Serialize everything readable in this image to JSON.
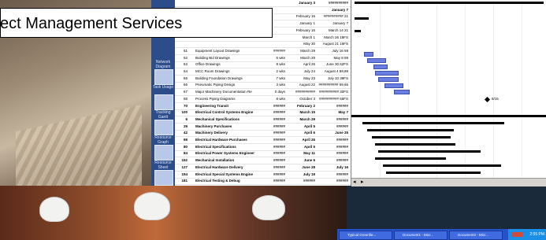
{
  "title": "ect Management Services",
  "side_rail": [
    {
      "label": "Network Diagram"
    },
    {
      "label": "Task Usage"
    },
    {
      "label": "Tracking Gantt"
    },
    {
      "label": "Resource Graph"
    },
    {
      "label": "Resource Sheet"
    }
  ],
  "rows": [
    {
      "id": "",
      "name": "",
      "dur": "",
      "start": "January 3",
      "end": "##########",
      "bold": true
    },
    {
      "id": "",
      "name": "",
      "dur": "",
      "start": "",
      "end": "January 7",
      "bold": true
    },
    {
      "id": "",
      "name": "",
      "dur": "",
      "start": "February 16",
      "end": "########## 21",
      "bold": false
    },
    {
      "id": "",
      "name": "",
      "dur": "",
      "start": "January 1",
      "end": "January 7",
      "bold": false
    },
    {
      "id": "",
      "name": "",
      "dur": "",
      "start": "February 16",
      "end": "March 14 21",
      "bold": false
    },
    {
      "id": "",
      "name": "",
      "dur": "",
      "start": "March 1",
      "end": "March 26 18FS",
      "bold": false
    },
    {
      "id": "",
      "name": "",
      "dur": "",
      "start": "May 30",
      "end": "August 21 16FS",
      "bold": false
    },
    {
      "id": "61",
      "name": "Equipment Layout Drawings",
      "dur": "######",
      "start": "March 29",
      "end": "July 16 59",
      "bold": false
    },
    {
      "id": "62",
      "name": "Building Bid Drawings",
      "dur": "6 wks",
      "start": "March 29",
      "end": "May 8 59",
      "bold": false
    },
    {
      "id": "63",
      "name": "Office Drawings",
      "dur": "8 wks",
      "start": "April 26",
      "end": "June 30 62FS",
      "bold": false
    },
    {
      "id": "64",
      "name": "MCC Room Drawings",
      "dur": "2 wks",
      "start": "July 24",
      "end": "August 4 59,89",
      "bold": false
    },
    {
      "id": "65",
      "name": "Building Foundation Drawings",
      "dur": "7 wks",
      "start": "May 23",
      "end": "July 10 39FS",
      "bold": false
    },
    {
      "id": "66",
      "name": "Pneumatic Piping Design",
      "dur": "3 wks",
      "start": "August 22",
      "end": "########## 59,65",
      "bold": false
    },
    {
      "id": "67",
      "name": "Major Machinery Documentation Re",
      "dur": "0 days",
      "start": "##########",
      "end": "########## 30FS",
      "bold": false
    },
    {
      "id": "68",
      "name": "Process Piping Diagrams",
      "dur": "8 wks",
      "start": "October 3",
      "end": "########## 65FS",
      "bold": false
    },
    {
      "id": "70",
      "name": "Engineering Transit",
      "dur": "######",
      "start": "February 2",
      "end": "######",
      "bold": true
    },
    {
      "id": "100",
      "name": "Electrical Control Systems Engine",
      "dur": "######",
      "start": "March 15",
      "end": "May 7",
      "bold": true
    },
    {
      "id": "6",
      "name": "Mechanical Specifications",
      "dur": "######",
      "start": "March 29",
      "end": "######",
      "bold": true
    },
    {
      "id": "29",
      "name": "Machinery Purchases",
      "dur": "######",
      "start": "April 5",
      "end": "######",
      "bold": true
    },
    {
      "id": "42",
      "name": "Machinery Delivery",
      "dur": "######",
      "start": "April 6",
      "end": "June 25",
      "bold": true
    },
    {
      "id": "69",
      "name": "Electrical Hardware Purchases",
      "dur": "######",
      "start": "April 26",
      "end": "######",
      "bold": true
    },
    {
      "id": "80",
      "name": "Electrical Specifications",
      "dur": "######",
      "start": "April 5",
      "end": "######",
      "bold": true
    },
    {
      "id": "84",
      "name": "Electrical Power Systems Engineer",
      "dur": "######",
      "start": "May 11",
      "end": "######",
      "bold": true
    },
    {
      "id": "162",
      "name": "Mechanical Installation",
      "dur": "######",
      "start": "June 6",
      "end": "######",
      "bold": true
    },
    {
      "id": "127",
      "name": "Electrical Hardware Delivery",
      "dur": "######",
      "start": "June 28",
      "end": "July 16",
      "bold": true
    },
    {
      "id": "194",
      "name": "Electrical Special Systems Engine",
      "dur": "######",
      "start": "July 19",
      "end": "######",
      "bold": true
    },
    {
      "id": "181",
      "name": "Electrical Testing & Debug",
      "dur": "######",
      "start": "######",
      "end": "######",
      "bold": true
    }
  ],
  "milestone_label": "8/15",
  "taskbar": {
    "buttons": [
      "Typical Greenfie...",
      "Document1 - Micr...",
      "Document2 - Micr..."
    ],
    "clock": "2:55 PM"
  }
}
